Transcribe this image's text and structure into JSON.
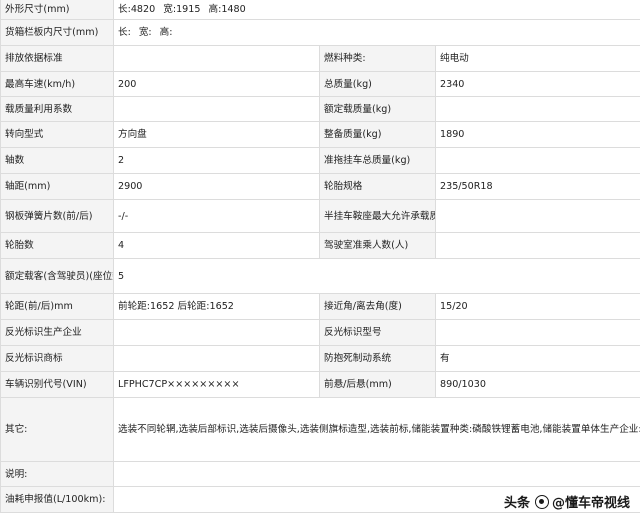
{
  "rows": {
    "r1": {
      "l1": "外形尺寸(mm)",
      "len_label": "长:",
      "len": "4820",
      "wid_label": "宽:",
      "wid": "1915",
      "hgt_label": "高:",
      "hgt": "1480"
    },
    "r2": {
      "l1": "货箱栏板内尺寸(mm)",
      "len_label": "长:",
      "wid_label": "宽:",
      "hgt_label": "高:"
    },
    "r3": {
      "l1": "排放依据标准",
      "v1": "",
      "l2": "燃料种类:",
      "v2": "纯电动"
    },
    "r4": {
      "l1": "最高车速(km/h)",
      "v1": "200",
      "l2": "总质量(kg)",
      "v2": "2340"
    },
    "r5": {
      "l1": "载质量利用系数",
      "v1": "",
      "l2": "额定载质量(kg)",
      "v2": ""
    },
    "r6": {
      "l1": "转向型式",
      "v1": "方向盘",
      "l2": "整备质量(kg)",
      "v2": "1890"
    },
    "r7": {
      "l1": "轴数",
      "v1": "2",
      "l2": "准拖挂车总质量(kg)",
      "v2": ""
    },
    "r8": {
      "l1": "轴距(mm)",
      "v1": "2900",
      "l2": "轮胎规格",
      "v2": "235/50R18"
    },
    "r9": {
      "l1": "钢板弹簧片数(前/后)",
      "v1": "-/-",
      "l2": "半挂车鞍座最大允许承载质量(kg)",
      "v2": ""
    },
    "r10": {
      "l1": "轮胎数",
      "v1": "4",
      "l2": "驾驶室准乘人数(人)",
      "v2": ""
    },
    "r11": {
      "l1": "额定载客(含驾驶员)(座位数)",
      "v1": "5"
    },
    "r12": {
      "l1": "轮距(前/后)mm",
      "v1": "前轮距:1652 后轮距:1652",
      "l2": "接近角/离去角(度)",
      "v2": "15/20"
    },
    "r13": {
      "l1": "反光标识生产企业",
      "v1": "",
      "l2": "反光标识型号",
      "v2": ""
    },
    "r14": {
      "l1": "反光标识商标",
      "v1": "",
      "l2": "防抱死制动系统",
      "v2": "有"
    },
    "r15": {
      "l1": "车辆识别代号(VIN)",
      "v1": "LFPHC7CP×××××××××",
      "l2": "前悬/后悬(mm)",
      "v2": "890/1030"
    },
    "r16": {
      "l1": "其它:",
      "v1": "选装不同轮辋,选装后部标识,选装后摄像头,选装侧旗标造型,选装前标,储能装置种类:磷酸铁锂蓄电池,储能装置单体生产企业:宁德时代新能源科技股份有限公司,时代一汽动力电池有限公司,储能装置总成生产企业:中国第一汽车集团有限公司,电机额定功率:70kW,峰值功率:210kW,ABS系统生产厂家:博世汽车部件(苏州)有限公司,型号:IPB1.1;该车型可选装ETC车载装置.该车配备汽车事件数据记录系统(EDR)"
    },
    "r17": {
      "l1": "说明:",
      "v1": ""
    },
    "r18": {
      "l1": "油耗申报值(L/100km):",
      "v1": ""
    }
  },
  "watermark": {
    "brand": "头条",
    "text": "@懂车帝视线",
    "icon": "toutiao-circle-icon"
  }
}
